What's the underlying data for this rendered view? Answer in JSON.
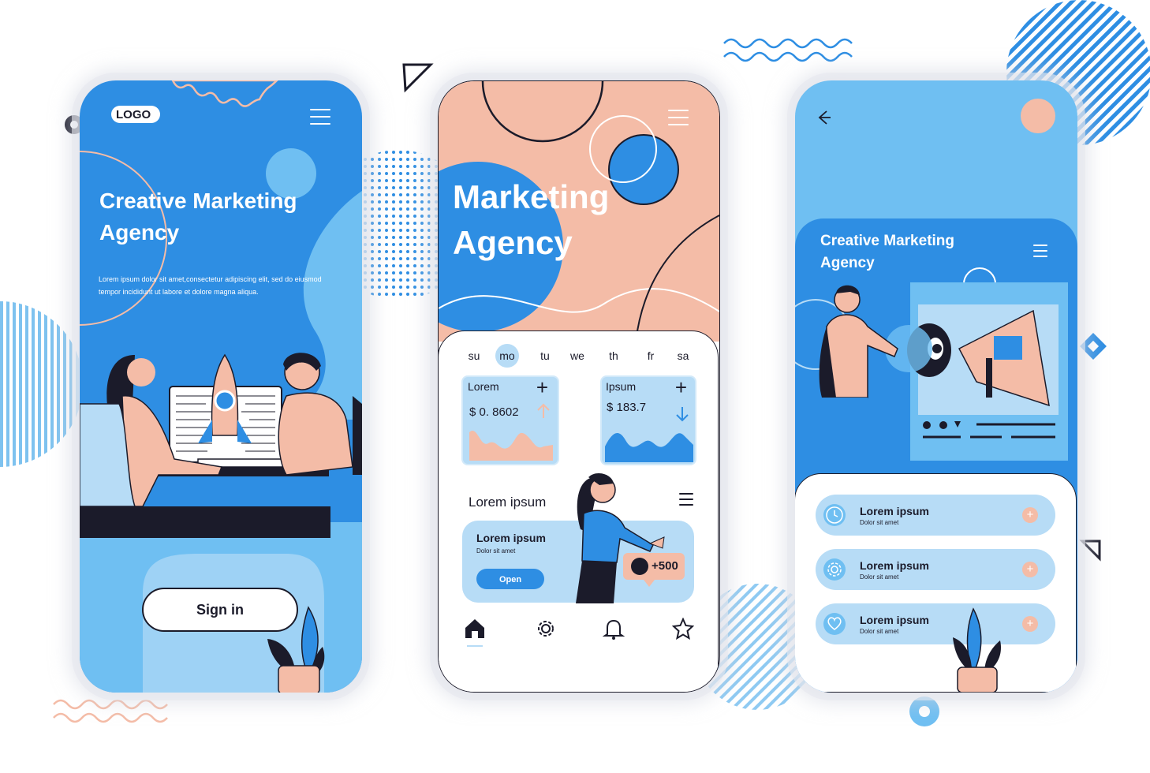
{
  "screen1": {
    "logo": "LOGO",
    "title_line1": "Creative Marketing",
    "title_line2": "Agency",
    "body_line1": "Lorem ipsum dolor sit amet,consectetur adipiscing elit, sed do eiusmod",
    "body_line2": "tempor incididunt ut labore et dolore magna aliqua.",
    "signin_label": "Sign in"
  },
  "screen2": {
    "title_line1": "Marketing",
    "title_line2": "Agency",
    "days": [
      "su",
      "mo",
      "tu",
      "we",
      "th",
      "fr",
      "sa"
    ],
    "selected_day": "mo",
    "card1": {
      "label": "Lorem",
      "value": "$ 0. 8602",
      "plus": "+"
    },
    "card2": {
      "label": "Ipsum",
      "value": "$ 183.7",
      "plus": "+"
    },
    "section_title": "Lorem ipsum",
    "promo": {
      "title": "Lorem ipsum",
      "subtitle": "Dolor sit amet",
      "button": "Open",
      "badge": "+500"
    },
    "nav_icons": [
      "home-icon",
      "gear-icon",
      "bell-icon",
      "star-icon"
    ]
  },
  "screen3": {
    "title_line1": "Creative Marketing",
    "title_line2": "Agency",
    "items": [
      {
        "title": "Lorem ipsum",
        "subtitle": "Dolor sit amet",
        "icon": "clock-icon",
        "plus": "+"
      },
      {
        "title": "Lorem ipsum",
        "subtitle": "Dolor sit amet",
        "icon": "gear-icon",
        "plus": "+"
      },
      {
        "title": "Lorem ipsum",
        "subtitle": "Dolor sit amet",
        "icon": "heart-icon",
        "plus": "+"
      }
    ]
  },
  "colors": {
    "blue": "#2e8ee3",
    "light_blue": "#6fbff2",
    "pale_blue": "#b7dcf6",
    "peach": "#f4bca7",
    "ink": "#1b1b2a"
  }
}
